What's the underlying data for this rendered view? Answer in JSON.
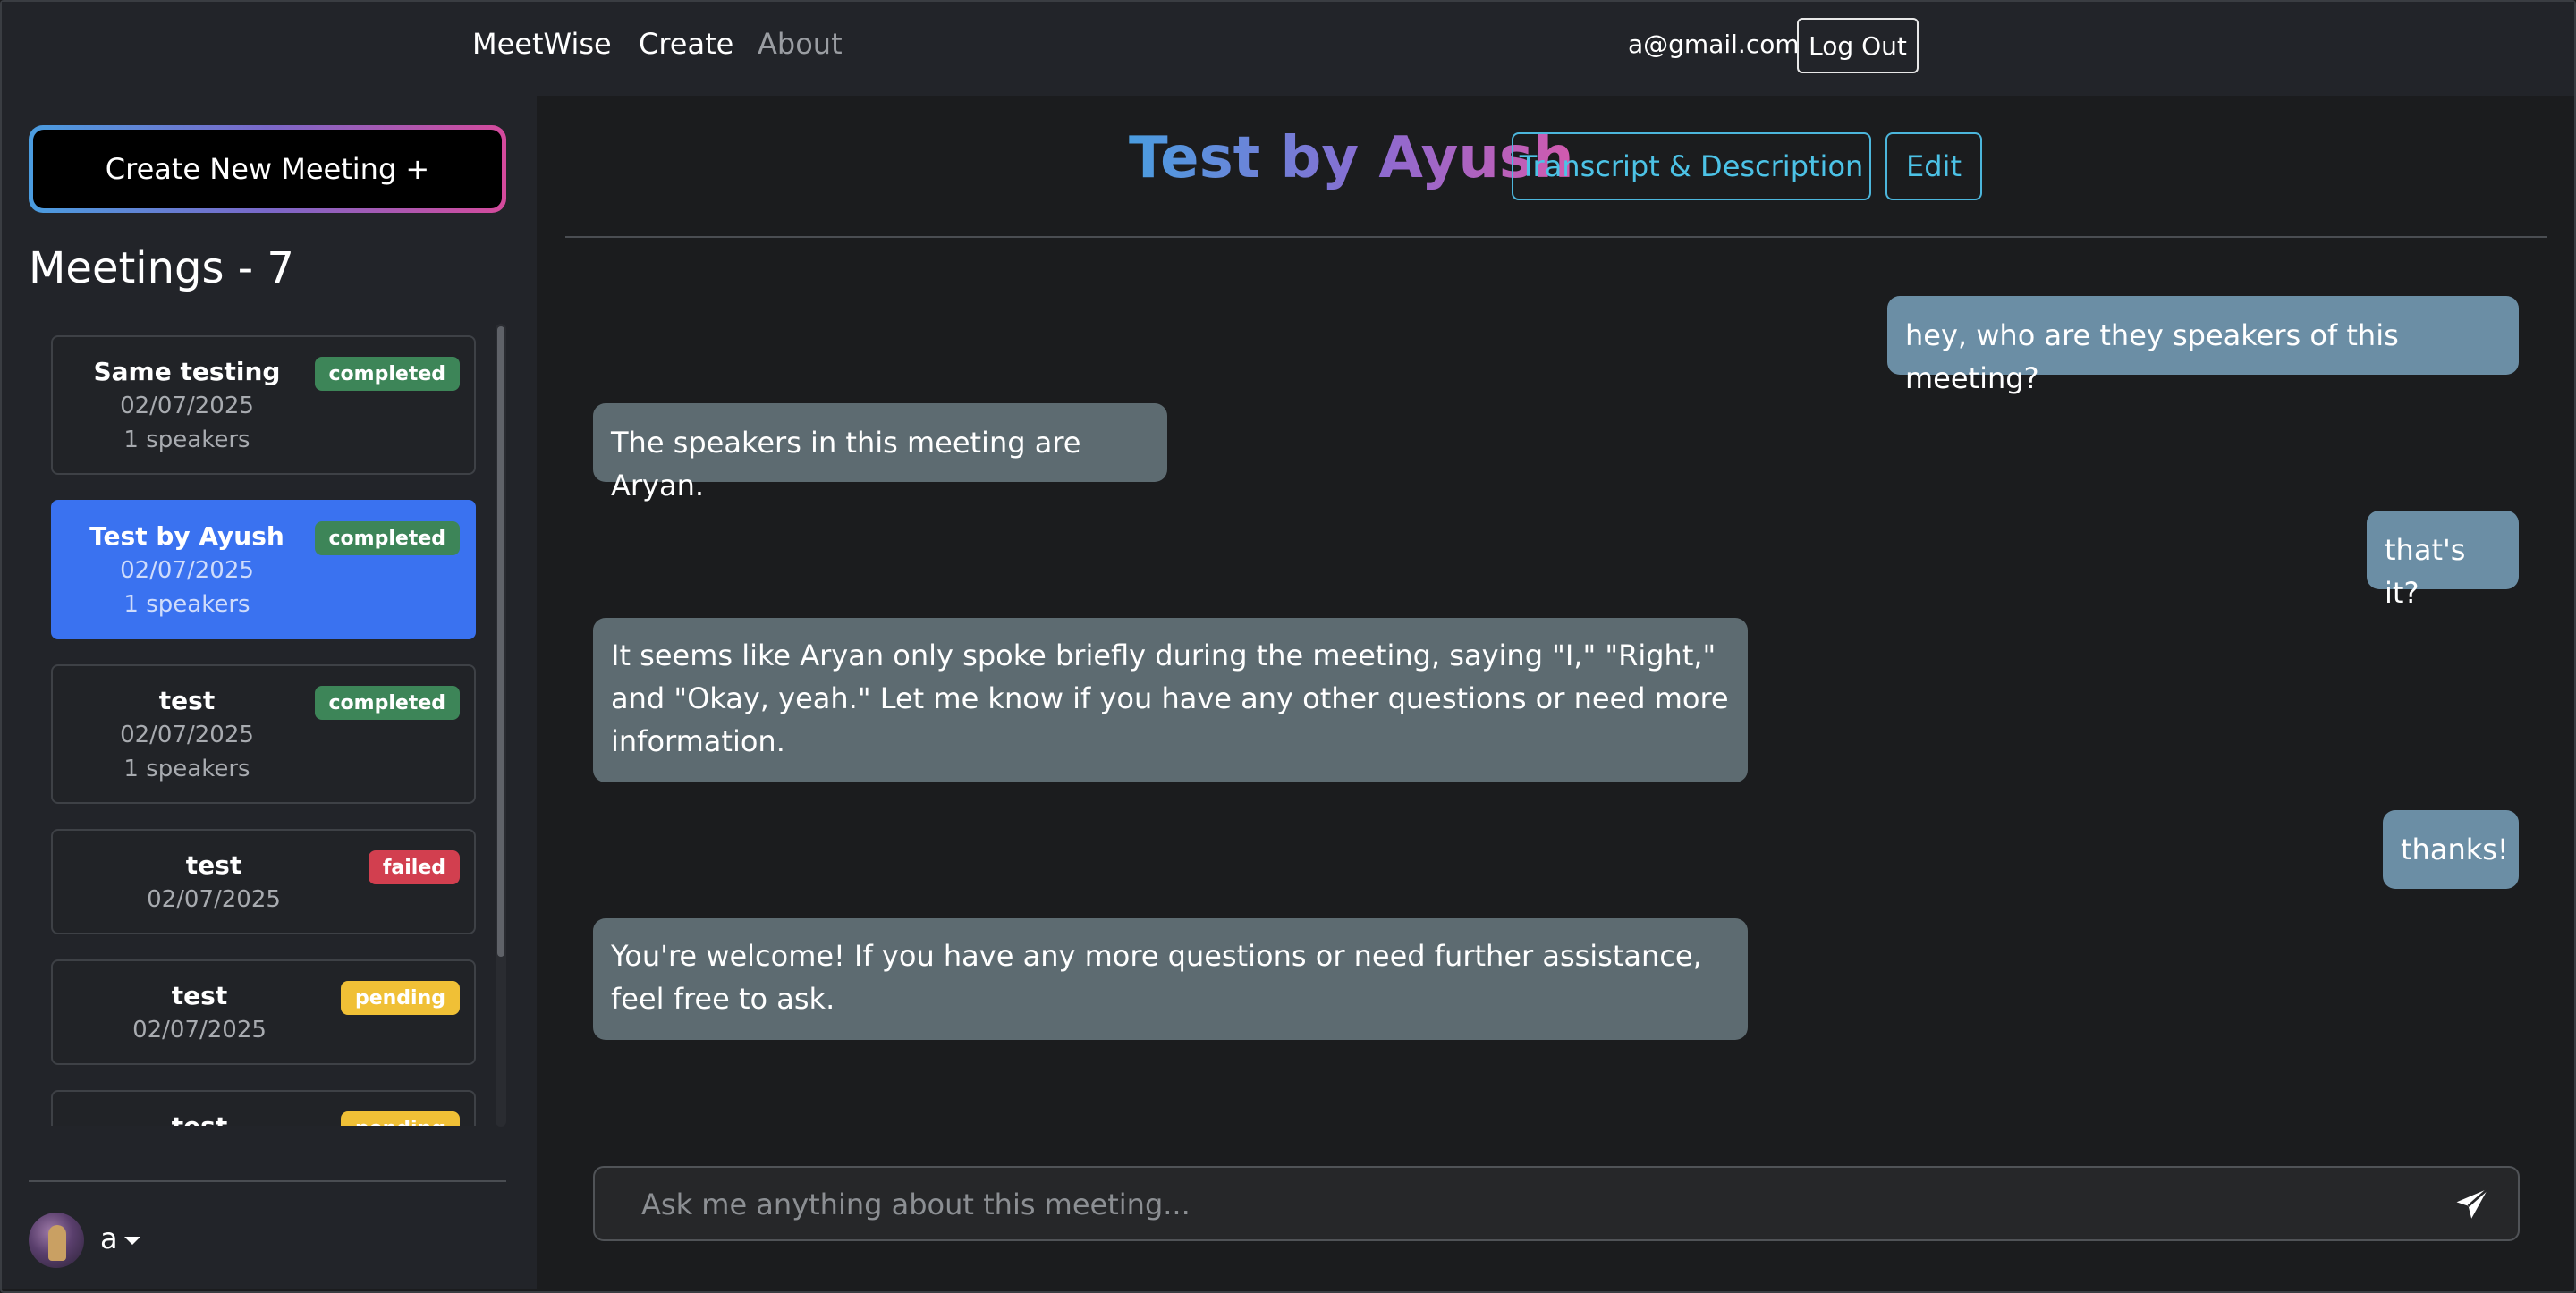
{
  "navbar": {
    "brand": "MeetWise",
    "links": [
      "Create",
      "About"
    ],
    "email": "a@gmail.com",
    "logout_label": "Log Out"
  },
  "sidebar": {
    "create_button_label": "Create New Meeting +",
    "meetings_heading": "Meetings - 7",
    "meetings": [
      {
        "title": "Same testing",
        "date": "02/07/2025",
        "speakers": "1 speakers",
        "status": "completed",
        "active": false
      },
      {
        "title": "Test by Ayush",
        "date": "02/07/2025",
        "speakers": "1 speakers",
        "status": "completed",
        "active": true
      },
      {
        "title": "test",
        "date": "02/07/2025",
        "speakers": "1 speakers",
        "status": "completed",
        "active": false
      },
      {
        "title": "test",
        "date": "02/07/2025",
        "status": "failed",
        "active": false
      },
      {
        "title": "test",
        "date": "02/07/2025",
        "status": "pending",
        "active": false
      },
      {
        "title": "test",
        "status": "pending",
        "active": false
      }
    ],
    "user_name": "a"
  },
  "main": {
    "title": "Test by Ayush",
    "transcript_button": "Transcript & Description",
    "edit_button": "Edit",
    "messages": [
      {
        "role": "user",
        "text": "hey, who are they speakers of this meeting?"
      },
      {
        "role": "assistant",
        "text": "The speakers in this meeting are Aryan."
      },
      {
        "role": "user",
        "text": "that's it?"
      },
      {
        "role": "assistant",
        "text": "It seems like Aryan only spoke briefly during the meeting, saying \"I,\" \"Right,\" and \"Okay, yeah.\" Let me know if you have any other questions or need more information."
      },
      {
        "role": "user",
        "text": "thanks!"
      },
      {
        "role": "assistant",
        "text": "You're welcome! If you have any more questions or need further assistance, feel free to ask."
      }
    ],
    "input_placeholder": "Ask me anything about this meeting..."
  },
  "colors": {
    "background": "#1b1c1e",
    "panel": "#222429",
    "active_card": "#3a72f0",
    "badge_completed": "#3d8558",
    "badge_failed": "#d23f4f",
    "badge_pending": "#f0c036",
    "user_bubble": "#6b8ea5",
    "assistant_bubble": "#5d6b71",
    "accent_outline": "#4cb6dc"
  },
  "icons": {
    "send": "paper-plane-icon",
    "caret": "caret-down-icon",
    "avatar": "user-avatar"
  }
}
